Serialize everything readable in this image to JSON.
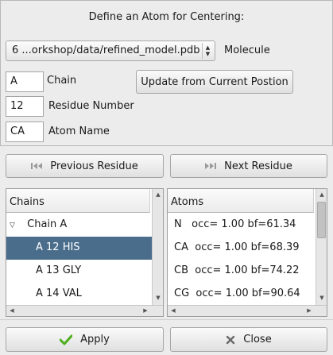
{
  "dialog": {
    "title": "Define an Atom for Centering:"
  },
  "molecule": {
    "selected": "6 ...orkshop/data/refined_model.pdb",
    "label": "Molecule"
  },
  "chain": {
    "value": "A",
    "label": "Chain"
  },
  "update_button": {
    "label": "Update from Current Postion"
  },
  "residue": {
    "value": "12",
    "label": "Residue Number"
  },
  "atom": {
    "value": "CA",
    "label": "Atom Name"
  },
  "nav": {
    "previous_label": "Previous Residue",
    "previous_icon": "previous-icon",
    "next_label": "Next Residue",
    "next_icon": "next-icon"
  },
  "chains_list": {
    "header": "Chains",
    "items": [
      {
        "label": "Chain A",
        "expanded": true
      },
      {
        "label": "A 12 HIS",
        "selected": true
      },
      {
        "label": "A 13 GLY"
      },
      {
        "label": "A 14 VAL"
      }
    ]
  },
  "atoms_list": {
    "header": "Atoms",
    "items": [
      {
        "label": "N   occ= 1.00 bf=61.34"
      },
      {
        "label": "CA  occ= 1.00 bf=68.39"
      },
      {
        "label": "CB  occ= 1.00 bf=74.22"
      },
      {
        "label": "CG  occ= 1.00 bf=90.64"
      }
    ]
  },
  "actions": {
    "apply_label": "Apply",
    "apply_icon": "check-icon",
    "close_label": "Close",
    "close_icon": "close-icon"
  },
  "colors": {
    "selection": "#4a6d8c",
    "apply_check": "#4caf1e"
  }
}
